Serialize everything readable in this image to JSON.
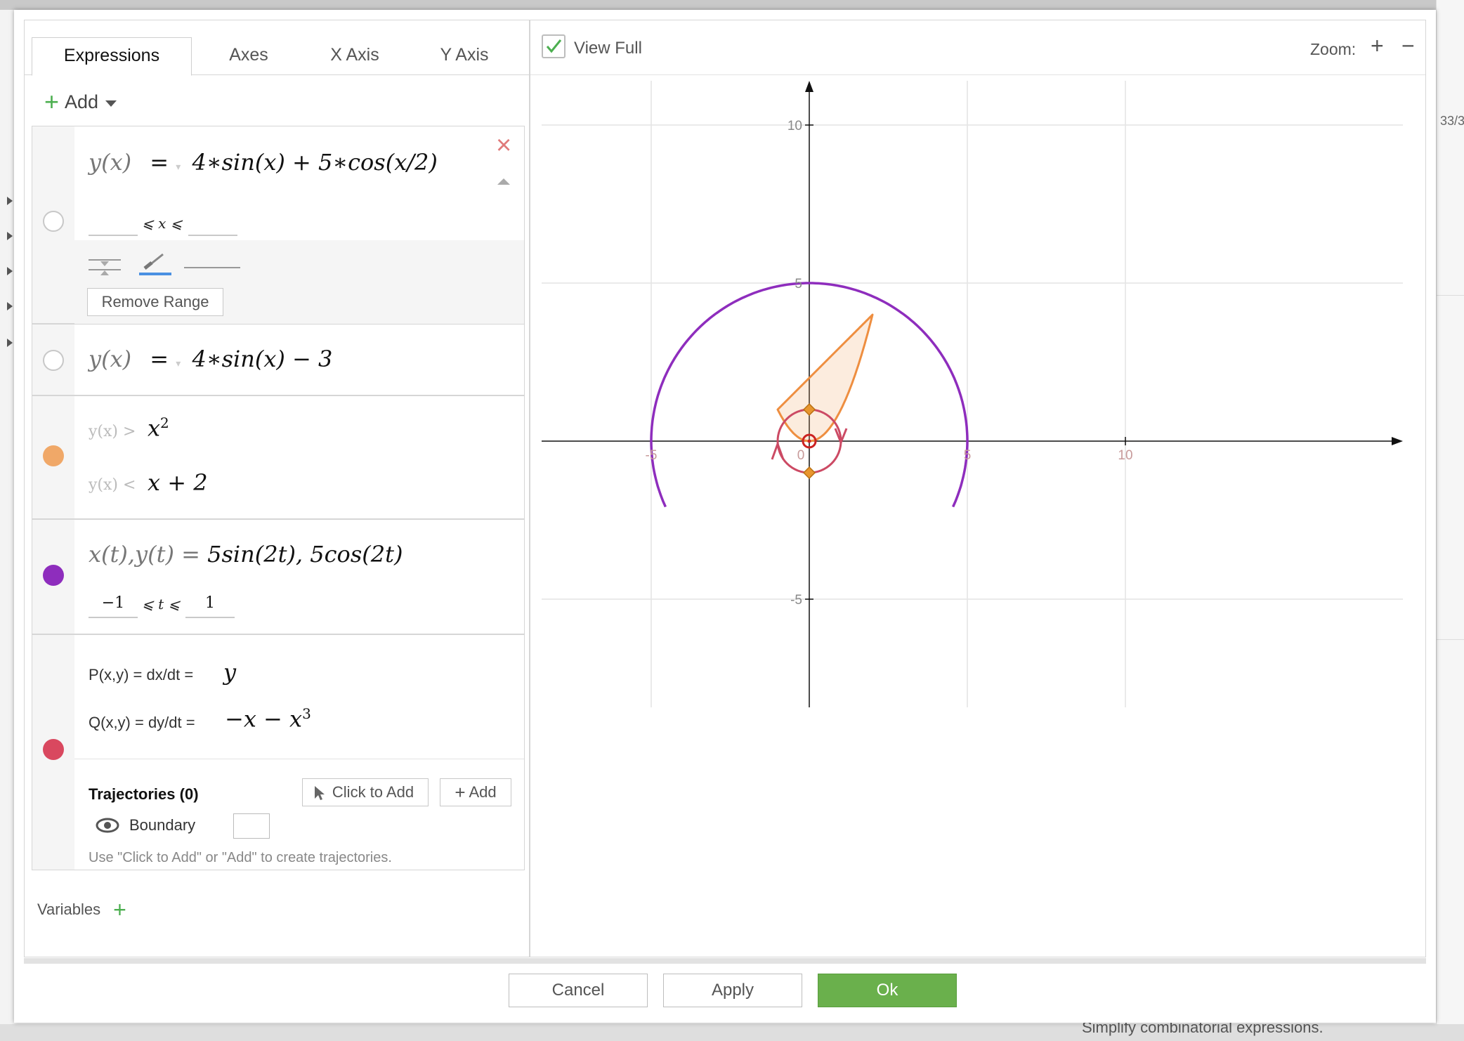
{
  "background": {
    "right_fragment": "33/3",
    "bottom_fragment": "Simplify combinatorial expressions."
  },
  "tabs": [
    {
      "label": "Expressions",
      "active": true
    },
    {
      "label": "Axes",
      "active": false
    },
    {
      "label": "X Axis",
      "active": false
    },
    {
      "label": "Y Axis",
      "active": false
    }
  ],
  "add_button": {
    "label": "Add"
  },
  "expressions": {
    "e1": {
      "lhs": "y(x)",
      "eq": "=",
      "rhs": "4∗sin(x) + 5∗cos(x/2)",
      "range_op": "⩽ x ⩽",
      "remove_range_label": "Remove Range",
      "color": "#4a90e2"
    },
    "e2": {
      "lhs": "y(x)",
      "eq": "=",
      "rhs": "4∗sin(x) − 3"
    },
    "e3": {
      "line1_prefix": "y(x) >",
      "line1_expr": "x",
      "line1_sup": "2",
      "line2_prefix": "y(x) <",
      "line2_expr": "x + 2",
      "color": "#f0a868"
    },
    "e4": {
      "lhs": "x(t),y(t) =",
      "rhs": "5sin(2t), 5cos(2t)",
      "range_min": "−1",
      "range_op": "⩽ t ⩽",
      "range_max": "1",
      "color": "#8e2dbd"
    },
    "e5": {
      "p_label": "P(x,y) = dx/dt =",
      "p_expr": "y",
      "q_label": "Q(x,y) = dy/dt =",
      "q_expr": "−x − x",
      "q_sup": "3",
      "color": "#d9485f",
      "trajectories_label": "Trajectories (0)",
      "click_to_add_label": "Click to Add",
      "add_label": "Add",
      "boundary_label": "Boundary",
      "hint": "Use \"Click to Add\" or \"Add\" to create trajectories."
    }
  },
  "variables": {
    "label": "Variables"
  },
  "graph": {
    "view_full_label": "View Full",
    "view_full_checked": true,
    "zoom_label": "Zoom:",
    "zoom_in": "+",
    "zoom_out": "−",
    "x_ticks": [
      "-5",
      "0",
      "5",
      "10"
    ],
    "y_ticks": [
      "10",
      "5",
      "-5"
    ],
    "xlim": [
      -6.5,
      12
    ],
    "ylim": [
      -7,
      13
    ]
  },
  "footer": {
    "cancel_label": "Cancel",
    "apply_label": "Apply",
    "ok_label": "Ok"
  }
}
